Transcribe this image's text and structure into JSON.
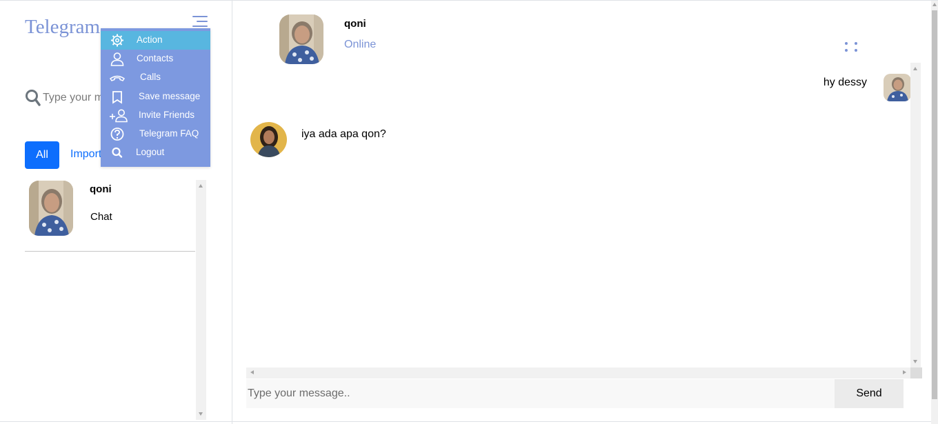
{
  "brand": "Telegram",
  "search": {
    "placeholder": "Type your message.."
  },
  "filters": {
    "all": "All",
    "important": "Important"
  },
  "chats": [
    {
      "name": "qoni",
      "preview": "Chat"
    }
  ],
  "menu": {
    "items": [
      {
        "label": "Action",
        "icon": "gear-icon"
      },
      {
        "label": "Contacts",
        "icon": "person-icon"
      },
      {
        "label": "Calls",
        "icon": "phone-icon"
      },
      {
        "label": "Save message",
        "icon": "bookmark-icon"
      },
      {
        "label": "Invite Friends",
        "icon": "add-user-icon"
      },
      {
        "label": "Telegram FAQ",
        "icon": "question-icon"
      },
      {
        "label": "Logout",
        "icon": "search-icon"
      }
    ]
  },
  "conversation": {
    "name": "qoni",
    "status": "Online",
    "messages": [
      {
        "from": "me",
        "text": "hy dessy"
      },
      {
        "from": "them",
        "text": "iya ada apa qon?"
      }
    ],
    "composer_placeholder": "Type your message..",
    "send_label": "Send"
  },
  "colors": {
    "accent": "#7b93d6",
    "primary": "#0d6efd",
    "menu_bg": "#7d99e0",
    "menu_active": "#58b6e0"
  }
}
